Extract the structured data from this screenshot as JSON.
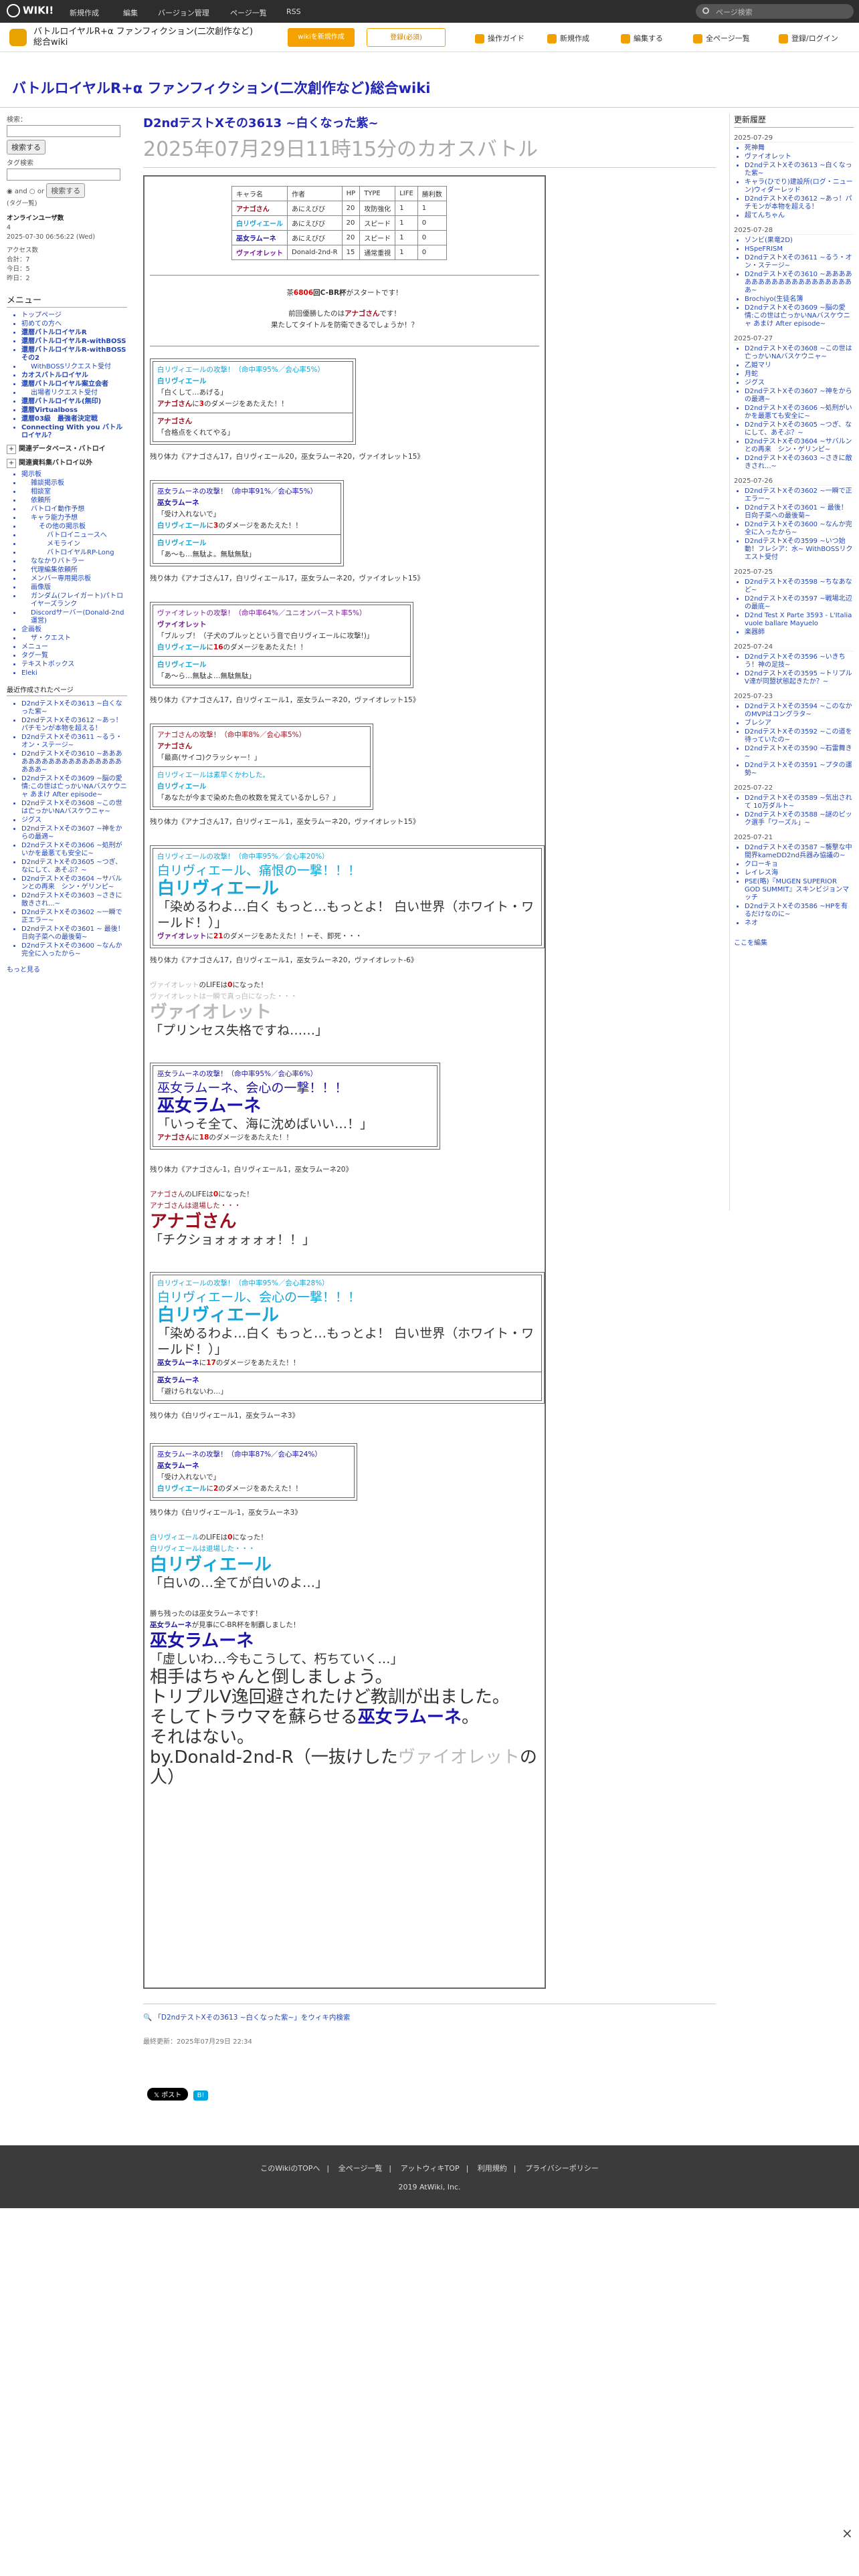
{
  "topbar": {
    "logo": "WIKI!",
    "menus": [
      "新規作成",
      "編集",
      "バージョン管理",
      "ページ一覧",
      "RSS"
    ],
    "search_placeholder": "ページ検索"
  },
  "header": {
    "site_name": "バトルロイヤルR+α ファンフィクション(二次創作など)総合wiki",
    "btn_wiki": "wikiを新規作成",
    "btn_register": "登録(必須)",
    "tools": [
      "操作ガイド",
      "新規作成",
      "編集する",
      "全ページ一覧",
      "登録/ログイン"
    ]
  },
  "wiki_title": "バトルロイヤルR+α ファンフィクション(二次創作など)総合wiki",
  "left": {
    "search_label": "検索：",
    "search_btn": "検索する",
    "tag_label": "タグ検索",
    "and": "and",
    "or": "or",
    "search_btn2": "検索する",
    "tag_list": "(タグ一覧)",
    "online_title": "オンラインユーザ数",
    "online_count": "4",
    "online_time": "2025-07-30 06:56:22 (Wed)",
    "access_title": "アクセス数",
    "access_total": "合計：7",
    "access_today": "今日：5",
    "access_yesterday": "昨日：2",
    "menu_title": "メニュー",
    "menu": [
      {
        "t": "トップページ",
        "lv": 0,
        "b": false
      },
      {
        "t": "初めての方へ",
        "lv": 0,
        "b": false
      },
      {
        "t": "還暦バトルロイヤルR",
        "lv": 0,
        "b": true
      },
      {
        "t": "還暦バトルロイヤルR-withBOSS",
        "lv": 0,
        "b": true
      },
      {
        "t": "還暦バトルロイヤルR-withBOSSその2",
        "lv": 0,
        "b": true
      },
      {
        "t": "WithBOSSリクエスト受付",
        "lv": 1,
        "b": false
      },
      {
        "t": "カオスバトルロイヤル",
        "lv": 0,
        "b": true
      },
      {
        "t": "還暦バトルロイヤル案立会者",
        "lv": 0,
        "b": true
      },
      {
        "t": "出場者リクエスト受付",
        "lv": 1,
        "b": false
      },
      {
        "t": "還暦バトルロイヤル(無印)",
        "lv": 0,
        "b": true
      },
      {
        "t": "還暦Virtualboss",
        "lv": 0,
        "b": true
      },
      {
        "t": "還暦03級　最強者決定戦",
        "lv": 0,
        "b": true
      },
      {
        "t": "Connecting With you バトルロイヤル？",
        "lv": 0,
        "b": true
      }
    ],
    "toggle1": "関連データベース・バトロイ",
    "toggle2": "関連資料集バトロイ以外",
    "menu2": [
      {
        "t": "掲示板",
        "lv": 0
      },
      {
        "t": "雑談掲示板",
        "lv": 1
      },
      {
        "t": "相談室",
        "lv": 1
      },
      {
        "t": "依頼所",
        "lv": 1
      },
      {
        "t": "バトロイ動作予想",
        "lv": 1
      },
      {
        "t": "キャラ能力予想",
        "lv": 1
      },
      {
        "t": "その他の掲示板",
        "lv": 2
      },
      {
        "t": "バトロイニュースへ",
        "lv": 3
      },
      {
        "t": "メモライン",
        "lv": 3
      },
      {
        "t": "バトロイヤルRP-Long",
        "lv": 3
      },
      {
        "t": "ななかりバトラー",
        "lv": 1
      },
      {
        "t": "代理編集依頼所",
        "lv": 1
      },
      {
        "t": "メンバー専用掲示板",
        "lv": 1
      },
      {
        "t": "画像版",
        "lv": 1
      },
      {
        "t": "ガンダム(フレイガート)パトロイヤーズランク",
        "lv": 1
      },
      {
        "t": "Discordサーバー(Donald-2nd運営)",
        "lv": 1
      },
      {
        "t": "企画板",
        "lv": 0
      },
      {
        "t": "ザ・クエスト",
        "lv": 1
      },
      {
        "t": "メニュー",
        "lv": 0
      },
      {
        "t": "タグ一覧",
        "lv": 0
      },
      {
        "t": "テキストボックス",
        "lv": 0
      },
      {
        "t": "Eleki",
        "lv": 0
      }
    ],
    "recent_title": "最近作成されたページ",
    "recent": [
      "D2ndテストXその3613 ~白くなった紫~",
      "D2ndテストXその3612 ~あっ！パチモンが本物を超える！",
      "D2ndテストXその3611 ~るう・オン・ステージ~",
      "D2ndテストXその3610 ~あああああああああああああああああああああ~",
      "D2ndテストXその3609 ~脳の愛情:この世は亡っかいNAバスケウニャ あまけ After episode~",
      "D2ndテストXその3608 ~この世は亡っかいNAバスケウニャ~",
      "ジグス",
      "D2ndテストXその3607 ~神をからの最適~",
      "D2ndテストXその3606 ~処刑がいかを最悪ても安全に~",
      "D2ndテストXその3605 ~つぎ、なにして、あそぶ？~",
      "D2ndテストXその3604 ~サバルンとの再来　シン・ゲリンピ~",
      "D2ndテストXその3603 ~さきに敵きされ...~",
      "D2ndテストXその3602 ~一瞬で正エラー~",
      "D2ndテストXその3601 ~ 最後！日向子菜への最後菊~",
      "D2ndテストXその3600 ~なんか完全に入ったから~"
    ],
    "more": "もっと見る"
  },
  "right": {
    "title": "更新履歴",
    "groups": [
      {
        "date": "2025-07-29",
        "items": [
          "死神舞",
          "ヴァイオレット",
          "D2ndテストXその3613 ~白くなった紫~",
          "キャラ(ひでり)建設所(ログ・ニューン)ウィダーレッド",
          "D2ndテストXその3612 ~あっ！パチモンが本物を超える！",
          "超てんちゃん"
        ]
      },
      {
        "date": "2025-07-28",
        "items": [
          "ゾンビ(果竜2D)",
          "HSpeFRISM",
          "D2ndテストXその3611 ~るう・オン・ステージ~",
          "D2ndテストXその3610 ~あああああああああああああああああああああ~",
          "Brochiyo(生徒名簿",
          "D2ndテストXその3609 ~脳の愛情:この世は亡っかいNAバスケウニャ あまけ After episode~"
        ]
      },
      {
        "date": "2025-07-27",
        "items": [
          "D2ndテストXその3608 ~この世は亡っかいNAバスケウニャ~",
          "乙姫マリ",
          "月蛇",
          "ジグス",
          "D2ndテストXその3607 ~神をからの最適~",
          "D2ndテストXその3606 ~処刑がいかを最悪ても安全に~",
          "D2ndテストXその3605 ~つぎ、なにして、あそぶ？~",
          "D2ndテストXその3604 ~サバルンとの再来　シン・ゲリンピ~",
          "D2ndテストXその3603 ~さきに敵きされ...~"
        ]
      },
      {
        "date": "2025-07-26",
        "items": [
          "D2ndテストXその3602 ~一瞬で正エラー~",
          "D2ndテストXその3601 ~ 最後！日向子菜への最後菊~",
          "D2ndテストXその3600 ~なんか完全に入ったから~",
          "D2ndテストXその3599 ~いつ始動！フレシア：水~ WithBOSSリクエスト受付"
        ]
      },
      {
        "date": "2025-07-25",
        "items": [
          "D2ndテストXその3598 ~ちなあなど~",
          "D2ndテストXその3597 ~戦場北辺の最底~",
          "D2nd Test X Parte 3593 - L'Italia vuole ballare Mayuelo",
          "楽器師"
        ]
      },
      {
        "date": "2025-07-24",
        "items": [
          "D2ndテストXその3596 ~いきちう！神の足技~",
          "D2ndテストXその3595 ~トリプルV達が同盟状態起きたか？~"
        ]
      },
      {
        "date": "2025-07-23",
        "items": [
          "D2ndテストXその3594 ~このなかのMVPはコングラタ~",
          "ブレシア",
          "D2ndテストXその3592 ~この道を待っていたの~",
          "D2ndテストXその3590 ~石雷舞き~",
          "D2ndテストXその3591 ~プタの運勢~"
        ]
      },
      {
        "date": "2025-07-22",
        "items": [
          "D2ndテストXその3589 ~気出され て 10万ダルト~",
          "D2ndテストXその3588 ~謎のピック選手「ワーズル」~"
        ]
      },
      {
        "date": "2025-07-21",
        "items": [
          "D2ndテストXその3587 ~襲撃な中間界kameDD2nd兵器み協議の~",
          "クローキョ",
          "レイレス海",
          "PSE(略)『MUGEN SUPERIOR GOD SUMMIT』スキンビジョンマッチ",
          "D2ndテストXその3586 ~HPを有るだけなのに~",
          "ネオ"
        ]
      }
    ],
    "edit": "ここを編集"
  },
  "page": {
    "title1": "D2ndテストXその3613 ~白くなった紫~",
    "title2": "2025年07月29日11時15分のカオスバトル"
  },
  "stats": {
    "headers": [
      "キャラ名",
      "作者",
      "HP",
      "TYPE",
      "LIFE",
      "勝利数"
    ],
    "rows": [
      {
        "name": "アナゴさん",
        "author": "あにえびび",
        "hp": "20",
        "type": "攻防強化",
        "life": "1",
        "wins": "1"
      },
      {
        "name": "白リヴィエール",
        "author": "あにえびび",
        "hp": "20",
        "type": "スピード",
        "life": "1",
        "wins": "0"
      },
      {
        "name": "巫女ラムーネ",
        "author": "あにえびび",
        "hp": "20",
        "type": "スピード",
        "life": "1",
        "wins": "0"
      },
      {
        "name": "ヴァイオレット",
        "author": "Donald-2nd-R",
        "hp": "15",
        "type": "通常重視",
        "life": "1",
        "wins": "0"
      }
    ]
  },
  "intro": {
    "l1a": "茶",
    "l1b": "6806",
    "l1c": "回C-BR杯",
    "l1d": "がスタートです！",
    "l2a": "前回優勝したのは",
    "l2b": "アナゴさん",
    "l2c": "です！",
    "l3": "果たしてタイトルを防衛できるでしょうか！？"
  },
  "colors": {
    "wh": "#17a5d6",
    "pk": "#1b14a8",
    "an": "#9a0f1e",
    "vi": "#7a1a9c",
    "gr": "#b9b9b9"
  },
  "b1": {
    "l1": "白リヴィエールの攻撃！（命中率95%／会心率5%）",
    "l2": "白リヴィエール",
    "l3": "「白くして…あげる」",
    "l4a": "アナゴさん",
    "l4b": "に",
    "l4c": "3",
    "l4d": "のダメージをあたえた！！",
    "l5": "アナゴさん",
    "l6": "「合格点をくれてやる」"
  },
  "hp1": "残り体力《アナゴさん17，白リヴィエール20，巫女ラムーネ20，ヴァイオレット15》",
  "b2": {
    "l1": "巫女ラムーネの攻撃！（命中率91%／会心率5%）",
    "l2": "巫女ラムーネ",
    "l3": "「受け入れないで」",
    "l4a": "白リヴィエール",
    "l4b": "に",
    "l4c": "3",
    "l4d": "のダメージをあたえた！！",
    "l5": "白リヴィエール",
    "l6": "「あ〜も…無駄よ。無駄無駄」"
  },
  "hp2": "残り体力《アナゴさん17，白リヴィエール17，巫女ラムーネ20，ヴァイオレット15》",
  "b3": {
    "l1": "ヴァイオレットの攻撃！（命中率64%／ユニオンバースト率5%）",
    "l2": "ヴァイオレット",
    "l3": "「ブルッブ！（子犬のブルッとという音で白リヴィエールに攻撃!)」",
    "l4a": "白リヴィエール",
    "l4b": "に",
    "l4c": "16",
    "l4d": "のダメージをあたえた！！",
    "l5": "白リヴィエール",
    "l6": "「あ〜ら…無駄よ…無駄無駄」"
  },
  "hp3": "残り体力《アナゴさん17，白リヴィエール1，巫女ラムーネ20，ヴァイオレット15》",
  "b4": {
    "l1": "アナゴさんの攻撃！（命中率8%／会心率5%）",
    "l2": "アナゴさん",
    "l3": "「最高(サイコ)クラッシャー！」",
    "l4": "白リヴィエールは素早くかわした。",
    "l5": "白リヴィエール",
    "l6": "「あなたが今まで染めた色の枚数を覚えているかしら？」"
  },
  "hp4": "残り体力《アナゴさん17，白リヴィエール1，巫女ラムーネ20，ヴァイオレット15》",
  "b5": {
    "l1": "白リヴィエールの攻撃！（命中率95%／会心率20%）",
    "l2": "白リヴィエール、痛恨の一撃！！！",
    "l3": "白リヴィエール",
    "l4": "「染めるわよ…白く もっと…もっとよ！ 白い世界（ホワイト・ワールド！）」",
    "l5a": "ヴァイオレット",
    "l5b": "に",
    "l5c": "21",
    "l5d": "のダメージをあたえた！！←そ、即死・・・"
  },
  "hp5": "残り体力《アナゴさん17，白リヴィエール1，巫女ラムーネ20，ヴァイオレット-6》",
  "dead1": {
    "l1a": "ヴァイオレット",
    "l1b": "のLIFEは",
    "l1c": "0",
    "l1d": "になった！",
    "l2": "ヴァイオレットは一瞬で真っ白になった・・・",
    "l3": "ヴァイオレット",
    "l4": "「プリンセス失格ですね……」"
  },
  "b6": {
    "l1": "巫女ラムーネの攻撃！（命中率95%／会心率6%）",
    "l2": "巫女ラムーネ、会心の一撃！！！",
    "l3": "巫女ラムーネ",
    "l4": "「いっそ全て、海に沈めばいい…！」",
    "l5a": "アナゴさん",
    "l5b": "に",
    "l5c": "18",
    "l5d": "のダメージをあたえた！！"
  },
  "hp6": "残り体力《アナゴさん-1，白リヴィエール1，巫女ラムーネ20》",
  "dead2": {
    "l1a": "アナゴさん",
    "l1b": "のLIFEは",
    "l1c": "0",
    "l1d": "になった！",
    "l2": "アナゴさんは退場した・・・",
    "l3": "アナゴさん",
    "l4": "「チクショォォォォォ！！」"
  },
  "b7": {
    "l1": "白リヴィエールの攻撃！（命中率95%／会心率28%）",
    "l2": "白リヴィエール、会心の一撃！！！",
    "l3": "白リヴィエール",
    "l4": "「染めるわよ…白く もっと…もっとよ！ 白い世界（ホワイト・ワールド！）」",
    "l5a": "巫女ラムーネ",
    "l5b": "に",
    "l5c": "17",
    "l5d": "のダメージをあたえた！！",
    "l6": "巫女ラムーネ",
    "l7": "「避けられないわ…」"
  },
  "hp7": "残り体力《白リヴィエール1，巫女ラムーネ3》",
  "b8": {
    "l1": "巫女ラムーネの攻撃！（命中率87%／会心率24%）",
    "l2": "巫女ラムーネ",
    "l3": "「受け入れないで」",
    "l4a": "白リヴィエール",
    "l4b": "に",
    "l4c": "2",
    "l4d": "のダメージをあたえた！！"
  },
  "hp8": "残り体力《白リヴィエール-1，巫女ラムーネ3》",
  "dead3": {
    "l1a": "白リヴィエール",
    "l1b": "のLIFEは",
    "l1c": "0",
    "l1d": "になった！",
    "l2": "白リヴィエールは退場した・・・",
    "l3": "白リヴィエール",
    "l4": "「白いの…全てが白いのよ…」"
  },
  "end": {
    "l1": "勝ち残ったのは巫女ラムーネです！",
    "l2a": "巫女ラムーネ",
    "l2b": "が見事にC-BR杯を制覇しました！",
    "l3": "巫女ラムーネ",
    "l4": "「虚しいわ…今もこうして、朽ちていく…」",
    "l5": "相手はちゃんと倒しましょう。",
    "l6": "トリプルV逸回避されたけど教訓が出ました。",
    "l7a": "そしてトラウマを蘇らせる",
    "l7b": "巫女ラムーネ",
    "l7c": "。",
    "l8": "それはない。",
    "l9a": "by.Donald-2nd-R（一抜けした",
    "l9b": "ヴァイオレット",
    "l9c": "の人）"
  },
  "search_link": "「D2ndテストXその3613 ~白くなった紫~」をウィキ内検索",
  "last_update": "最終更新：2025年07月29日 22:34",
  "share": {
    "x": "ポスト",
    "b": "B!"
  },
  "footer": {
    "links": [
      "このWikiのTOPへ",
      "全ページ一覧",
      "アットウィキTOP",
      "利用規約",
      "プライバシーポリシー"
    ],
    "copyright": "2019 AtWiki, Inc."
  },
  "close": "×"
}
